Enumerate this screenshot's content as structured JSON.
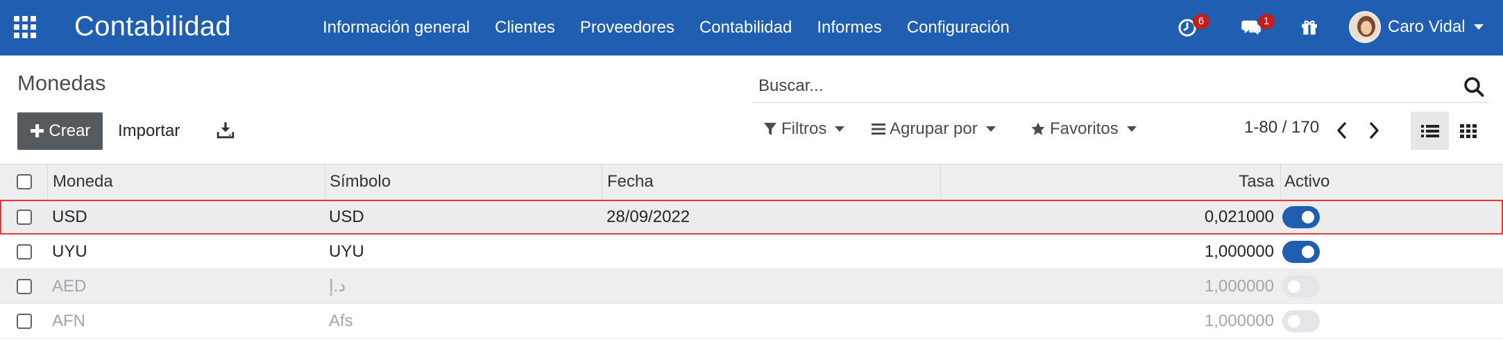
{
  "navbar": {
    "app_title": "Contabilidad",
    "menu": [
      {
        "label": "Información general"
      },
      {
        "label": "Clientes"
      },
      {
        "label": "Proveedores"
      },
      {
        "label": "Contabilidad"
      },
      {
        "label": "Informes"
      },
      {
        "label": "Configuración"
      }
    ],
    "activity_badge": "6",
    "messages_badge": "1",
    "user_name": "Caro Vidal",
    "icons": {
      "apps": "grid-icon",
      "activity": "clock-icon",
      "messages": "chat-icon",
      "gift": "gift-icon"
    }
  },
  "control_panel": {
    "title": "Monedas",
    "create_label": "Crear",
    "import_label": "Importar",
    "search_placeholder": "Buscar...",
    "filters_label": "Filtros",
    "group_by_label": "Agrupar por",
    "favorites_label": "Favoritos",
    "pager_text": "1-80 / 170"
  },
  "table": {
    "columns": {
      "currency": "Moneda",
      "symbol": "Símbolo",
      "date": "Fecha",
      "rate": "Tasa",
      "active": "Activo"
    },
    "rows": [
      {
        "currency": "USD",
        "symbol": "USD",
        "date": "28/09/2022",
        "rate": "0,021000",
        "active": true
      },
      {
        "currency": "UYU",
        "symbol": "UYU",
        "date": "",
        "rate": "1,000000",
        "active": true
      },
      {
        "currency": "AED",
        "symbol": "د.إ",
        "date": "",
        "rate": "1,000000",
        "active": false
      },
      {
        "currency": "AFN",
        "symbol": "Afs",
        "date": "",
        "rate": "1,000000",
        "active": false
      }
    ]
  },
  "colors": {
    "navbar": "#1f5eb1",
    "create_button": "#555a5f",
    "toggle_on": "#1f5eb1",
    "selection_outline": "#e03a3a",
    "badge": "#c41d1d"
  }
}
